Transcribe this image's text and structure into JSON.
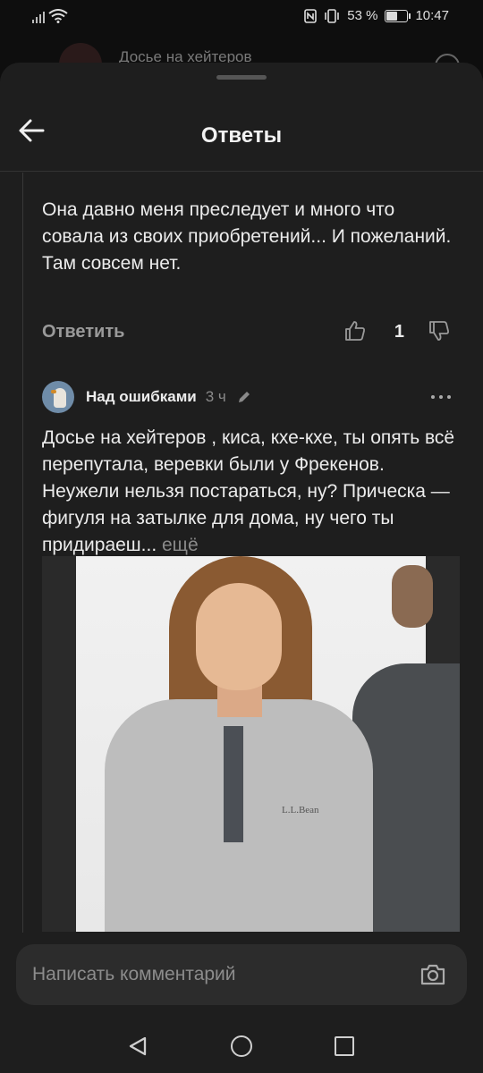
{
  "status_bar": {
    "battery": "53 %",
    "time": "10:47",
    "battery_level": 0.53
  },
  "background_page": {
    "title": "Досье на хейтеров"
  },
  "header": {
    "title": "Ответы"
  },
  "comment1": {
    "text": "Она давно меня преследует и много что совала из своих приобретений... И пожеланий.\nТам совсем нет.",
    "reply_label": "Ответить",
    "likes": "1"
  },
  "comment2": {
    "author": "Над ошибками",
    "time": "3 ч",
    "text": "Досье на хейтеров , киса, кхе-кхе, ты опять всё перепутала, веревки были у Фрекенов. Неужели нельзя постараться, ну? Прическа — фигуля на затылке для дома, ну чего ты придираеш...",
    "more_label": "ещё",
    "photo_brand": "L.L.Bean"
  },
  "composer": {
    "placeholder": "Написать комментарий"
  },
  "icons": {
    "back": "arrow-left-icon",
    "like": "thumbs-up-icon",
    "dislike": "thumbs-down-icon",
    "edit": "pencil-icon",
    "menu": "more-dots-icon",
    "camera": "camera-icon"
  }
}
